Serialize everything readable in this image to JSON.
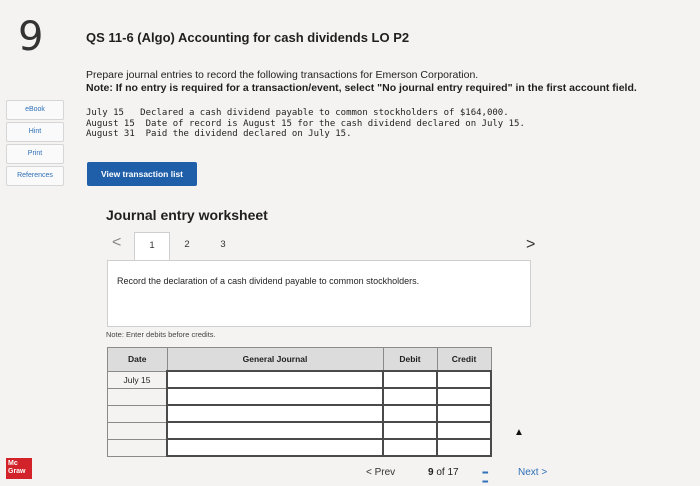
{
  "question": {
    "number": "9",
    "title": "QS 11-6 (Algo) Accounting for cash dividends LO P2",
    "instruction": "Prepare journal entries to record the following transactions for Emerson Corporation.",
    "note": "Note: If no entry is required for a transaction/event, select \"No journal entry required\" in the first account field.",
    "transactions": [
      "July 15   Declared a cash dividend payable to common stockholders of $164,000.",
      "August 15  Date of record is August 15 for the cash dividend declared on July 15.",
      "August 31  Paid the dividend declared on July 15."
    ]
  },
  "sidebar": {
    "ebook": "eBook",
    "hint": "Hint",
    "print": "Print",
    "references": "References",
    "logo": "Mc Graw"
  },
  "buttons": {
    "view_transaction_list": "View transaction list"
  },
  "worksheet": {
    "title": "Journal entry worksheet",
    "tabs": [
      "1",
      "2",
      "3"
    ],
    "prev_arrow": "<",
    "next_arrow": ">",
    "instruction": "Record the declaration of a cash dividend payable to common stockholders.",
    "debit_note": "Note: Enter debits before credits.",
    "table": {
      "headers": [
        "Date",
        "General Journal",
        "Debit",
        "Credit"
      ],
      "first_date": "July 15"
    }
  },
  "footer": {
    "prev": "< Prev",
    "current": "9",
    "of": "of 17",
    "next": "Next >"
  }
}
